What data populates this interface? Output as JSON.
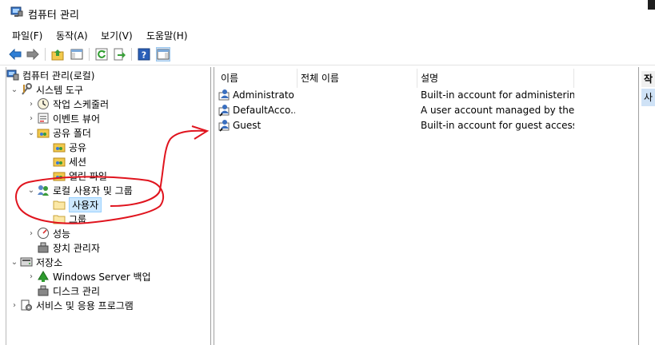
{
  "window": {
    "title": "컴퓨터 관리"
  },
  "menu": [
    "파일(F)",
    "동작(A)",
    "보기(V)",
    "도움말(H)"
  ],
  "toolbar": {
    "buttons": [
      "back-icon",
      "forward-icon",
      "up-folder-icon",
      "show-hide-tree-icon",
      "refresh-icon",
      "export-list-icon",
      "help-icon",
      "show-hide-action-pane-icon"
    ]
  },
  "tree": {
    "root": "컴퓨터 관리(로컬)",
    "system_tools": "시스템 도구",
    "task_scheduler": "작업 스케줄러",
    "event_viewer": "이벤트 뷰어",
    "shared_folders": "공유 폴더",
    "shares": "공유",
    "sessions": "세션",
    "open_files": "열린 파일",
    "local_users_groups": "로컬 사용자 및 그룹",
    "users": "사용자",
    "groups": "그룹",
    "performance": "성능",
    "device_manager": "장치 관리자",
    "storage": "저장소",
    "windows_server_backup": "Windows Server 백업",
    "disk_management": "디스크 관리",
    "services_apps": "서비스 및 응용 프로그램"
  },
  "list": {
    "columns": [
      "이름",
      "전체 이름",
      "설명"
    ],
    "rows": [
      {
        "name": "Administrator",
        "full_name": "",
        "description": "Built-in account for administerin..."
      },
      {
        "name": "DefaultAcco...",
        "full_name": "",
        "description": "A user account managed by the ..."
      },
      {
        "name": "Guest",
        "full_name": "",
        "description": "Built-in account for guest access..."
      }
    ]
  },
  "actions": {
    "title": "작",
    "selected": "사"
  },
  "colors": {
    "selection": "#cce8ff",
    "annotation": "#e0141e"
  }
}
